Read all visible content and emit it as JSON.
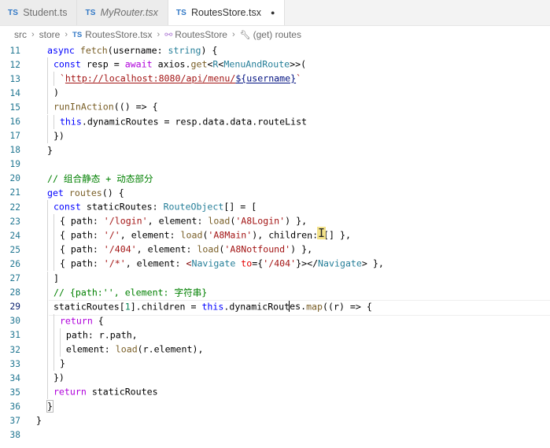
{
  "tabs": [
    {
      "label": "Student.ts",
      "italic": false,
      "active": false
    },
    {
      "label": "MyRouter.tsx",
      "italic": true,
      "active": false
    },
    {
      "label": "RoutesStore.tsx",
      "italic": false,
      "active": true,
      "dirty": true
    }
  ],
  "file_badge": "TS",
  "breadcrumb": {
    "src": "src",
    "store": "store",
    "file": "RoutesStore.tsx",
    "class": "RoutesStore",
    "member": "(get) routes"
  },
  "code": {
    "l11": {
      "n": "11",
      "a": "async",
      "b": " fetch",
      "c": "(username: ",
      "d": "string",
      "e": ") {"
    },
    "l12": {
      "n": "12",
      "a": "const",
      "b": " resp = ",
      "c": "await",
      "d": " axios.",
      "e": "get",
      "f": "<",
      "g": "R",
      "h": "<",
      "i": "MenuAndRoute",
      "j": ">>("
    },
    "l13": {
      "n": "13",
      "a": "`",
      "b": "http://localhost:8080/api/menu/",
      "c": "${username}",
      "d": "`"
    },
    "l14": {
      "n": "14",
      "a": ")"
    },
    "l15": {
      "n": "15",
      "a": "runInAction",
      "b": "(() => {"
    },
    "l16": {
      "n": "16",
      "a": "this",
      "b": ".dynamicRoutes = resp.data.data.routeList"
    },
    "l17": {
      "n": "17",
      "a": "})"
    },
    "l18": {
      "n": "18",
      "a": "}"
    },
    "l19": {
      "n": "19"
    },
    "l20": {
      "n": "20",
      "a": "// 组合静态 + 动态部分"
    },
    "l21": {
      "n": "21",
      "a": "get",
      "b": " routes",
      "c": "() {"
    },
    "l22": {
      "n": "22",
      "a": "const",
      "b": " staticRoutes: ",
      "c": "RouteObject",
      "d": "[] = ["
    },
    "l23": {
      "n": "23",
      "a": "{ path: ",
      "b": "'/login'",
      "c": ", element: ",
      "d": "load",
      "e": "(",
      "f": "'A8Login'",
      "g": ") },"
    },
    "l24": {
      "n": "24",
      "a": "{ path: ",
      "b": "'/'",
      "c": ", element: ",
      "d": "load",
      "e": "(",
      "f": "'A8Main'",
      "g": "), childre",
      "h": "n",
      "i": ": [] },"
    },
    "l25": {
      "n": "25",
      "a": "{ path: ",
      "b": "'/404'",
      "c": ", element: ",
      "d": "load",
      "e": "(",
      "f": "'A8Notfound'",
      "g": ") },"
    },
    "l26": {
      "n": "26",
      "a": "{ path: ",
      "b": "'/*'",
      "c": ", element: ",
      "d": "<",
      "e": "Navigate",
      "f": " to",
      "g": "={",
      "h": "'/404'",
      "i": "}></",
      "j": "Navigate",
      "k": "> },"
    },
    "l27": {
      "n": "27",
      "a": "]"
    },
    "l28": {
      "n": "28",
      "a": "// {path:'', element: 字符串}"
    },
    "l29": {
      "n": "29",
      "a": "staticRoutes[",
      "b": "1",
      "c": "].children = ",
      "d": "this",
      "e": ".dynamicRout",
      "f": "es.",
      "g": "map",
      "h": "((r) => {"
    },
    "l30": {
      "n": "30",
      "a": "return",
      "b": " {"
    },
    "l31": {
      "n": "31",
      "a": "path: r.path,"
    },
    "l32": {
      "n": "32",
      "a": "element: ",
      "b": "load",
      "c": "(r.element),"
    },
    "l33": {
      "n": "33",
      "a": "}"
    },
    "l34": {
      "n": "34",
      "a": "})"
    },
    "l35": {
      "n": "35",
      "a": "return",
      "b": " staticRoutes"
    },
    "l36": {
      "n": "36",
      "a": "}"
    },
    "l37": {
      "n": "37",
      "a": "}"
    },
    "l38": {
      "n": "38"
    }
  },
  "colors": {
    "keyword": "#0000ff",
    "control": "#af00db",
    "function": "#795e26",
    "type": "#267f99",
    "string": "#a31515",
    "comment": "#008000",
    "line_number": "#237893"
  }
}
